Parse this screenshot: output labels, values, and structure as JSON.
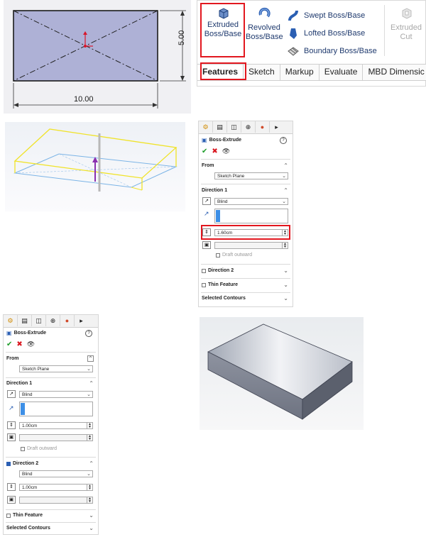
{
  "sketch": {
    "width_dim": "10.00",
    "height_dim": "5.00"
  },
  "toolbar": {
    "extruded_boss": [
      "Extruded",
      "Boss/Base"
    ],
    "revolved_boss": [
      "Revolved",
      "Boss/Base"
    ],
    "swept": "Swept Boss/Base",
    "lofted": "Lofted Boss/Base",
    "boundary": "Boundary Boss/Base",
    "extruded_cut": [
      "Extruded",
      "Cut"
    ],
    "tabs": [
      "Features",
      "Sketch",
      "Markup",
      "Evaluate",
      "MBD Dimensic"
    ],
    "accent": "#e2171f"
  },
  "pm1": {
    "title": "Boss-Extrude",
    "from_label": "From",
    "from_value": "Sketch Plane",
    "direction1_label": "Direction 1",
    "direction1_type": "Blind",
    "depth": "1.60cm",
    "draft_outward": "Draft outward",
    "direction2_label": "Direction 2",
    "thin_feature": "Thin Feature",
    "selected_contours": "Selected Contours"
  },
  "pm2": {
    "title": "Boss-Extrude",
    "from_label": "From",
    "from_value": "Sketch Plane",
    "direction1_label": "Direction 1",
    "direction1_type": "Blind",
    "depth1": "1.00cm",
    "draft_outward": "Draft outward",
    "direction2_label": "Direction 2",
    "direction2_type": "Blind",
    "depth2": "1.00cm",
    "thin_feature": "Thin Feature",
    "selected_contours": "Selected Contours"
  }
}
